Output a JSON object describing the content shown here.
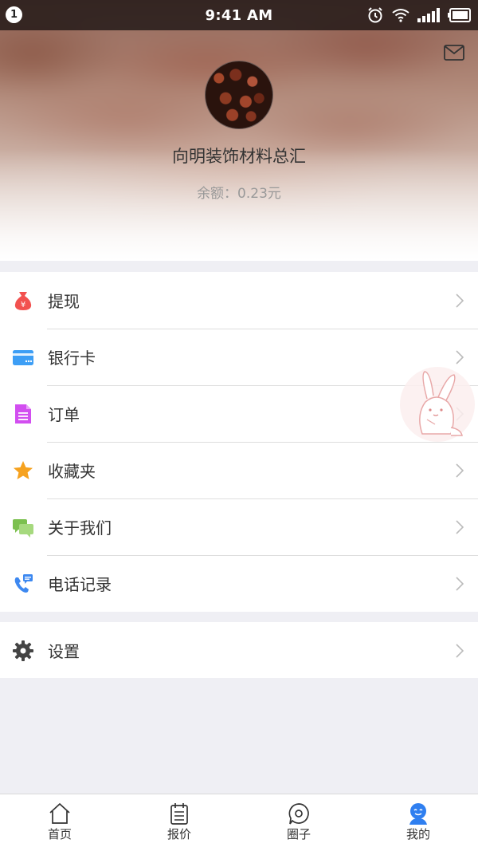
{
  "status_bar": {
    "notification_count": "1",
    "time": "9:41 AM",
    "icons": [
      "alarm-icon",
      "wifi-icon",
      "signal-icon",
      "battery-icon"
    ]
  },
  "profile": {
    "name": "向明装饰材料总汇",
    "balance": "余额：0.23元"
  },
  "menu": {
    "group1": [
      {
        "label": "提现",
        "icon": "money-bag-icon",
        "color": "#f2514f"
      },
      {
        "label": "银行卡",
        "icon": "bank-card-icon",
        "color": "#3d9ef5"
      },
      {
        "label": "订单",
        "icon": "order-document-icon",
        "color": "#d24ef0"
      },
      {
        "label": "收藏夹",
        "icon": "star-icon",
        "color": "#f6a21f"
      },
      {
        "label": "关于我们",
        "icon": "chat-bubbles-icon",
        "color": "#7cc04f"
      },
      {
        "label": "电话记录",
        "icon": "phone-log-icon",
        "color": "#3d88f0"
      }
    ],
    "group2": [
      {
        "label": "设置",
        "icon": "gear-icon",
        "color": "#444444"
      }
    ]
  },
  "tab_bar": {
    "tabs": [
      {
        "label": "首页",
        "icon": "home-icon",
        "active": false
      },
      {
        "label": "报价",
        "icon": "calendar-icon",
        "active": false
      },
      {
        "label": "圈子",
        "icon": "chat-circle-icon",
        "active": false
      },
      {
        "label": "我的",
        "icon": "profile-icon",
        "active": true
      }
    ],
    "active_color": "#2f7ff0"
  }
}
